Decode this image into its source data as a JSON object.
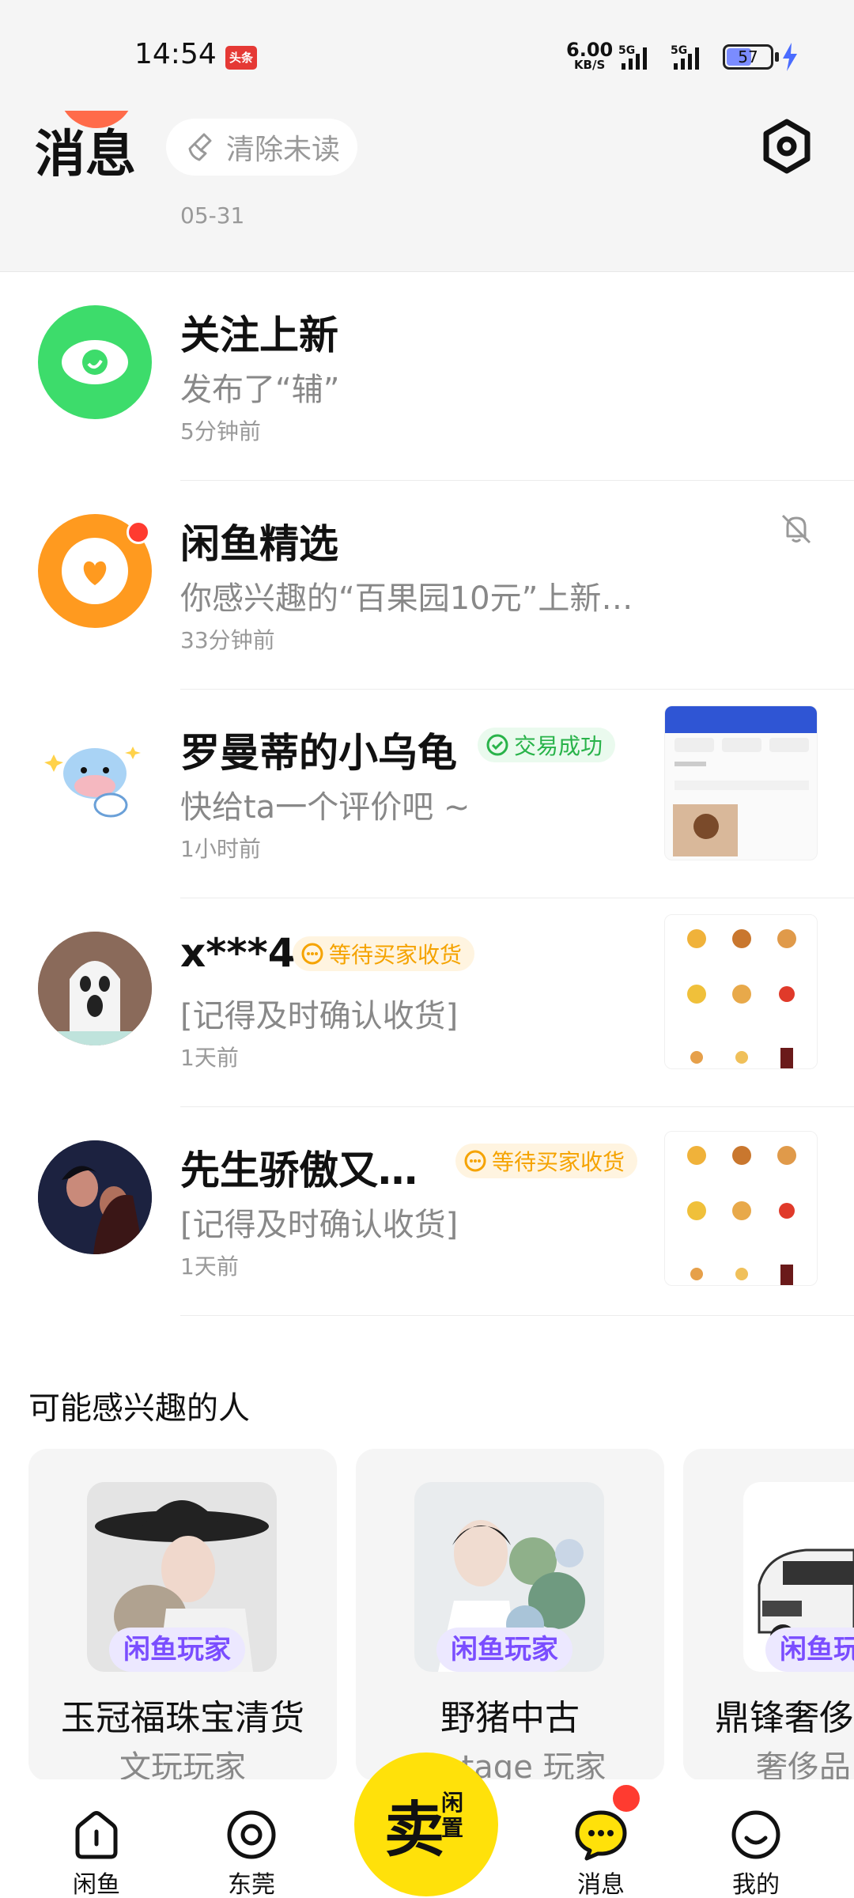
{
  "status_bar": {
    "time": "14:54",
    "notification_app": "头条",
    "net_speed_value": "6.00",
    "net_speed_unit": "KB/S",
    "signal_1": "5G",
    "signal_2": "5G",
    "battery_level": "57"
  },
  "header": {
    "title": "消息",
    "clear_unread_label": "清除未读",
    "previous_item_date": "05-31"
  },
  "messages": [
    {
      "name": "关注上新",
      "preview": "发布了“辅”",
      "time": "5分钟前"
    },
    {
      "name": "闲鱼精选",
      "preview": "你感兴趣的“百果园10元”上新…",
      "time": "33分钟前"
    },
    {
      "name": "罗曼蒂的小乌龟",
      "tag": "交易成功",
      "preview": "快给ta一个评价吧 ~",
      "time": "1小时前"
    },
    {
      "name": "x***4",
      "tag": "等待买家收货",
      "preview": "[记得及时确认收货]",
      "time": "1天前"
    },
    {
      "name": "先生骄傲又…",
      "tag": "等待买家收货",
      "preview": "[记得及时确认收货]",
      "time": "1天前"
    }
  ],
  "suggestions": {
    "title": "可能感兴趣的人",
    "cards": [
      {
        "name": "玉冠福珠宝清货",
        "badge": "闲鱼玩家",
        "subtitle": "文玩玩家"
      },
      {
        "name": "野猪中古",
        "badge": "闲鱼玩家",
        "subtitle": "vintage 玩家"
      },
      {
        "name": "鼎锋奢侈",
        "badge": "闲鱼玩",
        "subtitle": "奢侈品"
      }
    ]
  },
  "bottom_nav": {
    "items": [
      "闲鱼",
      "东莞",
      "消息",
      "我的"
    ],
    "sell_main": "卖",
    "sell_sub": "闲置"
  },
  "colors": {
    "accent_yellow": "#ffe10a",
    "unread_red": "#ff3b30",
    "success_green": "#29b34a",
    "pending_orange": "#f5a300",
    "badge_purple": "#7a4dff"
  }
}
